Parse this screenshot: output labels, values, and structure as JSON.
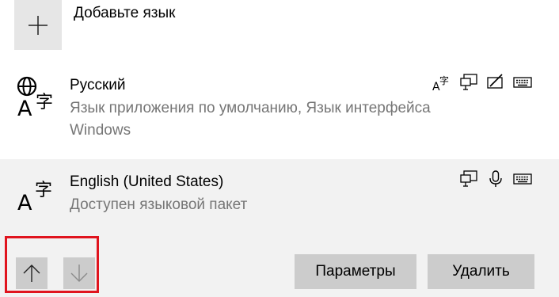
{
  "add_language": {
    "label": "Добавьте язык",
    "icon": "plus-icon"
  },
  "languages": [
    {
      "name": "Русский",
      "description": "Язык приложения по умолчанию, Язык интерфейса Windows",
      "icon": "language-globe-icon",
      "features": [
        "text-to-speech-icon",
        "display-language-icon",
        "handwriting-icon",
        "keyboard-icon"
      ]
    },
    {
      "name": "English (United States)",
      "description": "Доступен языковой пакет",
      "icon": "language-icon",
      "features": [
        "display-language-icon",
        "microphone-icon",
        "keyboard-icon"
      ]
    }
  ],
  "actions": {
    "move_up_icon": "arrow-up-icon",
    "move_down_icon": "arrow-down-icon",
    "options_label": "Параметры",
    "remove_label": "Удалить"
  },
  "colors": {
    "selected_row": "#f2f2f2",
    "button_bg": "#cccccc",
    "secondary_text": "#767676",
    "highlight_border": "#e0141e"
  }
}
